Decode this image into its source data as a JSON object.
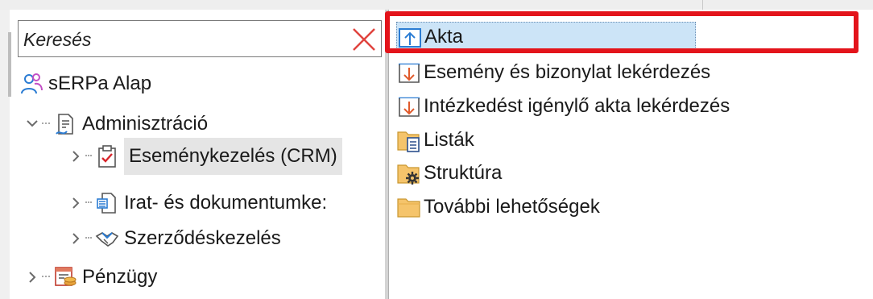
{
  "search": {
    "placeholder": "Keresés"
  },
  "tree": {
    "root": {
      "label": "sERPa Alap",
      "icon": "users-icon"
    },
    "nodes": [
      {
        "label": "Adminisztráció",
        "icon": "document-edit-icon",
        "expanded": true
      },
      {
        "label": "Eseménykezelés (CRM)",
        "icon": "clipboard-check-icon",
        "selected": true
      },
      {
        "label": "Irat- és dokumentumke:",
        "icon": "document-list-icon"
      },
      {
        "label": "Szerződéskezelés",
        "icon": "handshake-icon"
      },
      {
        "label": "Pénzügy",
        "icon": "finance-icon"
      }
    ]
  },
  "list": {
    "items": [
      {
        "label": "Akta",
        "icon": "record-icon",
        "selected": true
      },
      {
        "label": "Esemény és bizonylat lekérdezés",
        "icon": "query-icon"
      },
      {
        "label": "Intézkedést igénylő akta lekérdezés",
        "icon": "query-icon"
      },
      {
        "label": "Listák",
        "icon": "folder-list-icon"
      },
      {
        "label": "Struktúra",
        "icon": "folder-gear-icon"
      },
      {
        "label": "További lehetőségek",
        "icon": "folder-icon"
      }
    ]
  },
  "colors": {
    "highlight_frame": "#e3141b",
    "selection_blue": "#cce4f7",
    "tree_selection": "#e5e5e5",
    "clear_icon": "#e0443f",
    "accent_blue": "#2b7cd3"
  }
}
